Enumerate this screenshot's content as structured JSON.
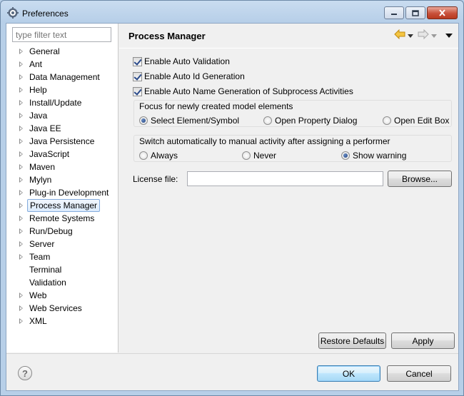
{
  "window": {
    "title": "Preferences"
  },
  "filter": {
    "placeholder": "type filter text",
    "value": ""
  },
  "tree": {
    "items": [
      {
        "label": "General",
        "expandable": true
      },
      {
        "label": "Ant",
        "expandable": true
      },
      {
        "label": "Data Management",
        "expandable": true
      },
      {
        "label": "Help",
        "expandable": true
      },
      {
        "label": "Install/Update",
        "expandable": true
      },
      {
        "label": "Java",
        "expandable": true
      },
      {
        "label": "Java EE",
        "expandable": true
      },
      {
        "label": "Java Persistence",
        "expandable": true
      },
      {
        "label": "JavaScript",
        "expandable": true
      },
      {
        "label": "Maven",
        "expandable": true
      },
      {
        "label": "Mylyn",
        "expandable": true
      },
      {
        "label": "Plug-in Development",
        "expandable": true
      },
      {
        "label": "Process Manager",
        "expandable": true,
        "selected": true
      },
      {
        "label": "Remote Systems",
        "expandable": true
      },
      {
        "label": "Run/Debug",
        "expandable": true
      },
      {
        "label": "Server",
        "expandable": true
      },
      {
        "label": "Team",
        "expandable": true
      },
      {
        "label": "Terminal",
        "expandable": false
      },
      {
        "label": "Validation",
        "expandable": false
      },
      {
        "label": "Web",
        "expandable": true
      },
      {
        "label": "Web Services",
        "expandable": true
      },
      {
        "label": "XML",
        "expandable": true
      }
    ]
  },
  "page": {
    "title": "Process Manager",
    "checkboxes": [
      {
        "label": "Enable Auto Validation",
        "checked": true
      },
      {
        "label": "Enable Auto Id Generation",
        "checked": true
      },
      {
        "label": "Enable Auto Name Generation of Subprocess Activities",
        "checked": true
      }
    ],
    "focus_group": {
      "title": "Focus for newly created model elements",
      "options": [
        "Select Element/Symbol",
        "Open Property Dialog",
        "Open Edit Box"
      ],
      "selected": "Select Element/Symbol"
    },
    "switch_group": {
      "title": "Switch automatically to manual activity after assigning a performer",
      "options": [
        "Always",
        "Never",
        "Show warning"
      ],
      "selected": "Show warning"
    },
    "license": {
      "label": "License file:",
      "value": "",
      "browse_label": "Browse..."
    },
    "restore_defaults_label": "Restore Defaults",
    "apply_label": "Apply"
  },
  "footer": {
    "ok_label": "OK",
    "cancel_label": "Cancel"
  },
  "icons": {
    "back": "back-arrow-icon",
    "forward": "forward-arrow-icon",
    "menu": "view-menu-icon",
    "help": "help-icon",
    "app": "preferences-gear-icon"
  },
  "colors": {
    "window_frame": "#b9d1ea",
    "selection_border": "#84acdd",
    "back_arrow": "#e8a317"
  }
}
